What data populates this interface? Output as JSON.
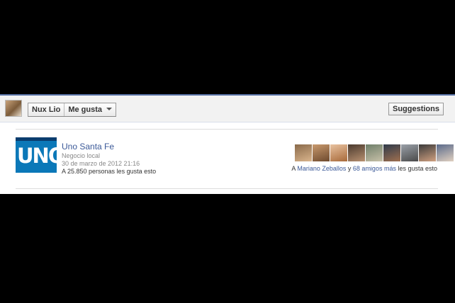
{
  "toolbar": {
    "user_name": "Nux Lio",
    "like_label": "Me gusta",
    "suggestions_label": "Suggestions"
  },
  "page": {
    "name": "Uno Santa Fe",
    "category": "Negocio local",
    "date": "30 de marzo de 2012 21:16",
    "likes_text": "A 25.850 personas les gusta esto",
    "logo_text": "UNO"
  },
  "friends": {
    "prefix": "A ",
    "friend_name": "Mariano Zeballos",
    "connector": " y ",
    "others": "68 amigos más",
    "suffix": " les gusta esto",
    "pictures": [
      {
        "colors": [
          "#8a6a4a",
          "#d9b48c"
        ]
      },
      {
        "colors": [
          "#c99a6e",
          "#6e4a2e"
        ]
      },
      {
        "colors": [
          "#e8c2a0",
          "#a86a3a"
        ]
      },
      {
        "colors": [
          "#4a3a2e",
          "#b89070"
        ]
      },
      {
        "colors": [
          "#6f7f6a",
          "#c7c0a8"
        ]
      },
      {
        "colors": [
          "#2e3a4a",
          "#a07050"
        ]
      },
      {
        "colors": [
          "#9aa0a8",
          "#4a4a4a"
        ]
      },
      {
        "colors": [
          "#3a3a3a",
          "#d0a080"
        ]
      },
      {
        "colors": [
          "#5a6a8a",
          "#e0d0c0"
        ]
      }
    ]
  },
  "colors": {
    "link": "#3b5998",
    "accent_border": "#5b74a8"
  }
}
